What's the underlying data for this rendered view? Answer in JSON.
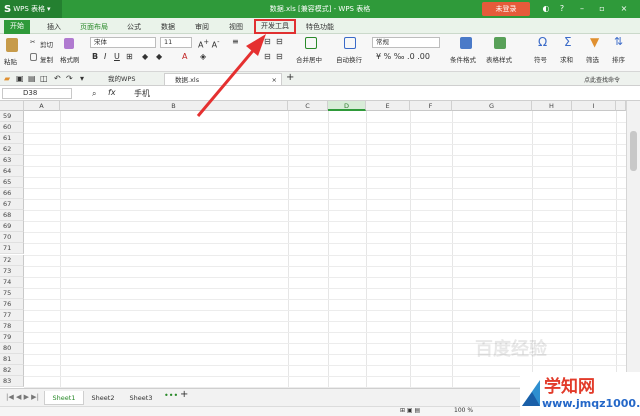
{
  "app": {
    "name": "WPS 表格",
    "doc_title": "数据.xls [兼容模式] - WPS 表格",
    "login": "未登录"
  },
  "menu_tabs": [
    "开始",
    "插入",
    "页面布局",
    "公式",
    "数据",
    "审阅",
    "视图",
    "开发工具",
    "特色功能"
  ],
  "ribbon": {
    "paste": "粘贴",
    "cut": "剪切",
    "copy": "复制",
    "format_painter": "格式刷",
    "font": "宋体",
    "font_size": "11",
    "merge": "合并居中",
    "wrap": "自动换行",
    "number_format": "常规",
    "cond_format": "条件格式",
    "table_style": "表格样式",
    "symbol": "符号",
    "sum": "求和",
    "filter": "筛选",
    "sort": "排序"
  },
  "doc_tabs": {
    "mywps": "我的WPS",
    "file": "数据.xls",
    "hint": "点此查找命令"
  },
  "formula_bar": {
    "cell_ref": "D38",
    "fx": "fx",
    "content": "手机"
  },
  "columns": [
    "A",
    "B",
    "C",
    "D",
    "E",
    "F",
    "G",
    "H",
    "I"
  ],
  "rows": [
    "59",
    "60",
    "61",
    "62",
    "63",
    "64",
    "65",
    "66",
    "67",
    "68",
    "69",
    "70",
    "71",
    "72",
    "73",
    "74",
    "75",
    "76",
    "77",
    "78",
    "79",
    "80",
    "81",
    "82",
    "83"
  ],
  "sheets": [
    "Sheet1",
    "Sheet2",
    "Sheet3"
  ],
  "status": {
    "zoom": "100 %"
  },
  "watermark": {
    "text": "百度经验"
  },
  "badge": {
    "brand": "学知网",
    "url": "www.jmqz1000.com"
  }
}
